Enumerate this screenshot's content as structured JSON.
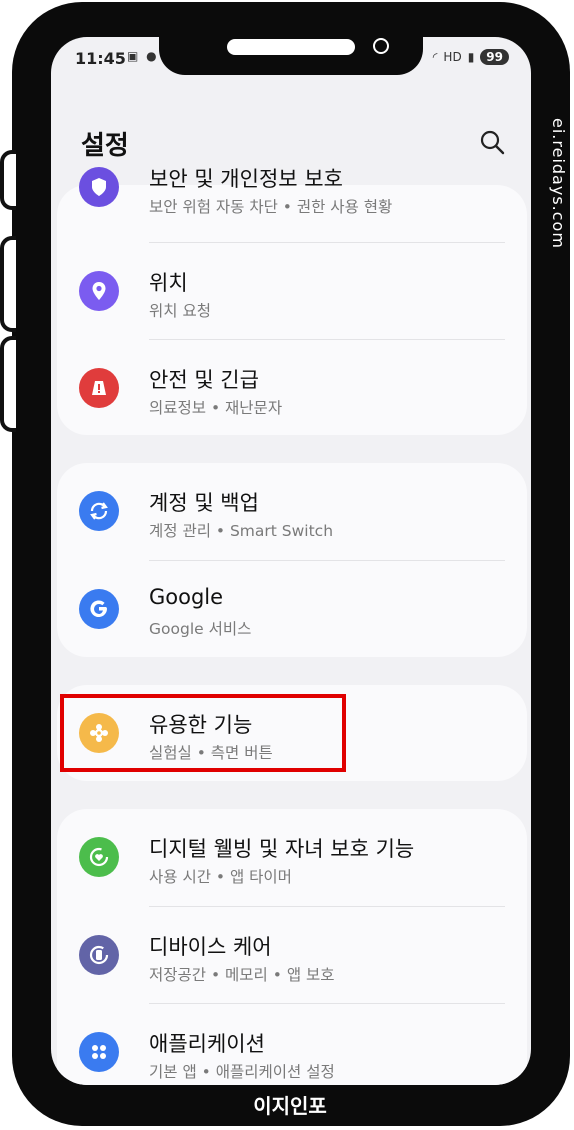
{
  "status_bar": {
    "time": "11:45",
    "left_icons": [
      "screenshot-icon",
      "talk-icon"
    ],
    "right_icons": [
      "wifi-icon",
      "hd-icon",
      "signal-icon"
    ],
    "hd_label": "HD",
    "battery": "99"
  },
  "header": {
    "title": "설정",
    "search_icon": "search-icon"
  },
  "groups": [
    {
      "items": [
        {
          "label": "보안 및 개인정보 보호",
          "sub": "보안 위험 자동 차단 • 권한 사용 현황",
          "icon": "shield-icon",
          "color": "#6b4fe0"
        },
        {
          "label": "위치",
          "sub": "위치 요청",
          "icon": "location-pin-icon",
          "color": "#7b5cf0"
        },
        {
          "label": "안전 및 긴급",
          "sub": "의료정보 • 재난문자",
          "icon": "emergency-icon",
          "color": "#e03c3c"
        }
      ]
    },
    {
      "items": [
        {
          "label": "계정 및 백업",
          "sub": "계정 관리 • Smart Switch",
          "icon": "sync-icon",
          "color": "#3a7bf0"
        },
        {
          "label": "Google",
          "sub": "Google 서비스",
          "icon": "google-icon",
          "color": "#3a7bf0"
        }
      ]
    },
    {
      "items": [
        {
          "label": "유용한 기능",
          "sub": "실험실 • 측면 버튼",
          "icon": "puzzle-icon",
          "color": "#f5b94a"
        }
      ]
    },
    {
      "items": [
        {
          "label": "디지털 웰빙 및 자녀 보호 기능",
          "sub": "사용 시간 • 앱 타이머",
          "icon": "wellbeing-icon",
          "color": "#4cbd4c"
        },
        {
          "label": "디바이스 케어",
          "sub": "저장공간 • 메모리 • 앱 보호",
          "icon": "device-care-icon",
          "color": "#6264a7"
        },
        {
          "label": "애플리케이션",
          "sub": "기본 앱 • 애플리케이션 설정",
          "icon": "apps-icon",
          "color": "#3a7bf0"
        }
      ]
    }
  ],
  "watermarks": {
    "side": "ei.reidays.com",
    "bottom": "이지인포"
  }
}
